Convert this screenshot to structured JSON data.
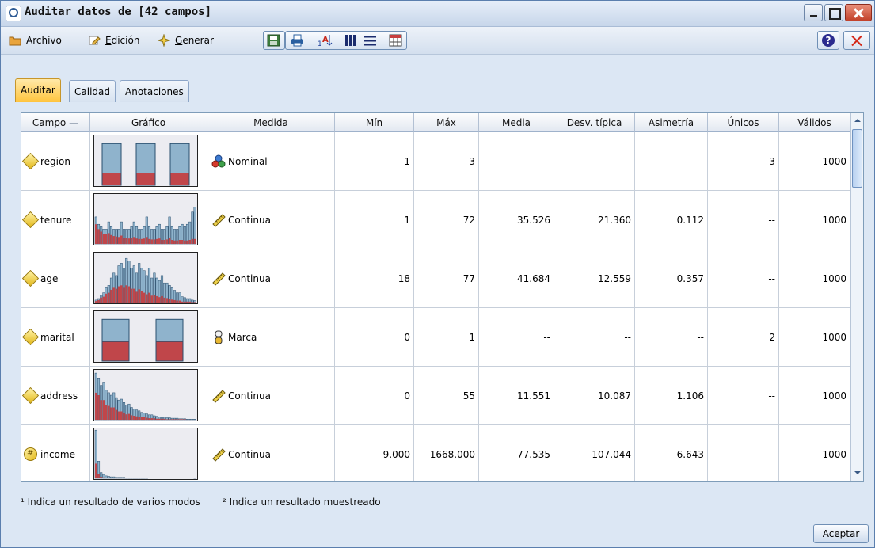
{
  "window": {
    "title": "Auditar datos de [42 campos]"
  },
  "menu": {
    "archivo": "Archivo",
    "edicion_first": "E",
    "edicion_rest": "dición",
    "generar_first": "G",
    "generar_rest": "enerar"
  },
  "tabs": [
    {
      "label": "Auditar",
      "active": true
    },
    {
      "label": "Calidad",
      "active": false
    },
    {
      "label": "Anotaciones",
      "active": false
    }
  ],
  "table": {
    "headers": [
      "Campo",
      "Gráfico",
      "Medida",
      "Mín",
      "Máx",
      "Media",
      "Desv. típica",
      "Asimetría",
      "Únicos",
      "Válidos"
    ],
    "sort_indicator": "—",
    "rows": [
      {
        "campo": "region",
        "medida": "Nominal",
        "min": "1",
        "max": "3",
        "media": "--",
        "desv": "--",
        "asim": "--",
        "unicos": "3",
        "validos": "1000",
        "field_icon": "diamond-icon",
        "medida_icon": "nominal-icon",
        "graph": {
          "type": "bars-3",
          "totals": [
            0.85,
            0.85,
            0.85
          ],
          "red": [
            0.25,
            0.25,
            0.25
          ]
        }
      },
      {
        "campo": "tenure",
        "medida": "Continua",
        "min": "1",
        "max": "72",
        "media": "35.526",
        "desv": "21.360",
        "asim": "0.112",
        "unicos": "--",
        "validos": "1000",
        "field_icon": "diamond-icon",
        "medida_icon": "ruler-icon",
        "graph": {
          "type": "hist",
          "totals": [
            0.55,
            0.4,
            0.35,
            0.3,
            0.3,
            0.45,
            0.35,
            0.3,
            0.3,
            0.3,
            0.45,
            0.3,
            0.3,
            0.3,
            0.35,
            0.45,
            0.35,
            0.3,
            0.3,
            0.35,
            0.55,
            0.35,
            0.3,
            0.3,
            0.35,
            0.4,
            0.3,
            0.3,
            0.35,
            0.55,
            0.35,
            0.3,
            0.3,
            0.35,
            0.4,
            0.35,
            0.4,
            0.45,
            0.65,
            0.75
          ],
          "red": [
            0.4,
            0.3,
            0.25,
            0.2,
            0.2,
            0.22,
            0.18,
            0.16,
            0.15,
            0.14,
            0.17,
            0.12,
            0.12,
            0.11,
            0.12,
            0.14,
            0.11,
            0.1,
            0.1,
            0.11,
            0.14,
            0.1,
            0.09,
            0.09,
            0.1,
            0.11,
            0.08,
            0.08,
            0.09,
            0.12,
            0.08,
            0.07,
            0.07,
            0.08,
            0.08,
            0.07,
            0.07,
            0.08,
            0.1,
            0.1
          ]
        }
      },
      {
        "campo": "age",
        "medida": "Continua",
        "min": "18",
        "max": "77",
        "media": "41.684",
        "desv": "12.559",
        "asim": "0.357",
        "unicos": "--",
        "validos": "1000",
        "field_icon": "diamond-icon",
        "medida_icon": "ruler-icon",
        "graph": {
          "type": "hist",
          "totals": [
            0.05,
            0.08,
            0.15,
            0.2,
            0.3,
            0.35,
            0.5,
            0.6,
            0.55,
            0.75,
            0.8,
            0.7,
            0.9,
            0.85,
            0.7,
            0.75,
            0.6,
            0.8,
            0.7,
            0.65,
            0.55,
            0.7,
            0.5,
            0.6,
            0.5,
            0.45,
            0.55,
            0.4,
            0.4,
            0.35,
            0.3,
            0.25,
            0.2,
            0.2,
            0.12,
            0.1,
            0.08,
            0.08,
            0.05,
            0.04
          ],
          "red": [
            0.03,
            0.05,
            0.1,
            0.12,
            0.18,
            0.2,
            0.26,
            0.3,
            0.28,
            0.33,
            0.35,
            0.3,
            0.35,
            0.33,
            0.28,
            0.28,
            0.22,
            0.27,
            0.23,
            0.2,
            0.17,
            0.2,
            0.14,
            0.16,
            0.13,
            0.11,
            0.13,
            0.1,
            0.09,
            0.08,
            0.06,
            0.05,
            0.04,
            0.04,
            0.02,
            0.02,
            0.02,
            0.02,
            0.01,
            0.01
          ]
        }
      },
      {
        "campo": "marital",
        "medida": "Marca",
        "min": "0",
        "max": "1",
        "media": "--",
        "desv": "--",
        "asim": "--",
        "unicos": "2",
        "validos": "1000",
        "field_icon": "diamond-icon",
        "medida_icon": "flag-icon",
        "graph": {
          "type": "bars-2",
          "totals": [
            0.85,
            0.85
          ],
          "red": [
            0.4,
            0.4
          ]
        }
      },
      {
        "campo": "address",
        "medida": "Continua",
        "min": "0",
        "max": "55",
        "media": "11.551",
        "desv": "10.087",
        "asim": "1.106",
        "unicos": "--",
        "validos": "1000",
        "field_icon": "diamond-icon",
        "medida_icon": "ruler-icon",
        "graph": {
          "type": "hist",
          "totals": [
            0.95,
            0.85,
            0.7,
            0.75,
            0.6,
            0.55,
            0.5,
            0.55,
            0.45,
            0.4,
            0.42,
            0.35,
            0.3,
            0.32,
            0.25,
            0.22,
            0.2,
            0.18,
            0.15,
            0.14,
            0.12,
            0.1,
            0.1,
            0.08,
            0.07,
            0.06,
            0.05,
            0.05,
            0.04,
            0.04,
            0.03,
            0.03,
            0.03,
            0.02,
            0.02,
            0.02,
            0.01,
            0.01,
            0.01,
            0.01
          ],
          "red": [
            0.55,
            0.5,
            0.4,
            0.4,
            0.3,
            0.28,
            0.25,
            0.25,
            0.2,
            0.17,
            0.17,
            0.14,
            0.11,
            0.12,
            0.09,
            0.08,
            0.07,
            0.06,
            0.05,
            0.05,
            0.04,
            0.03,
            0.03,
            0.03,
            0.02,
            0.02,
            0.02,
            0.02,
            0.01,
            0.01,
            0.01,
            0.01,
            0.01,
            0.01,
            0.01,
            0.01,
            0.0,
            0.0,
            0.0,
            0.0
          ]
        }
      },
      {
        "campo": "income",
        "medida": "Continua",
        "min": "9.000",
        "max": "1668.000",
        "media": "77.535",
        "desv": "107.044",
        "asim": "6.643",
        "unicos": "--",
        "validos": "1000",
        "field_icon": "money-icon",
        "medida_icon": "ruler-icon",
        "graph": {
          "type": "hist",
          "totals": [
            0.98,
            0.35,
            0.12,
            0.08,
            0.05,
            0.04,
            0.03,
            0.03,
            0.02,
            0.02,
            0.02,
            0.02,
            0.01,
            0.01,
            0.01,
            0.01,
            0.01,
            0.01,
            0.01,
            0.01,
            0.01,
            0.0,
            0.0,
            0.0,
            0.0,
            0.0,
            0.0,
            0.0,
            0.0,
            0.0,
            0.0,
            0.0,
            0.0,
            0.0,
            0.0,
            0.0,
            0.0,
            0.0,
            0.0,
            0.01
          ],
          "red": [
            0.3,
            0.08,
            0.03,
            0.02,
            0.01,
            0.01,
            0.01,
            0.01,
            0.0,
            0.0,
            0.0,
            0.0,
            0.0,
            0.0,
            0.0,
            0.0,
            0.0,
            0.0,
            0.0,
            0.0,
            0.0,
            0.0,
            0.0,
            0.0,
            0.0,
            0.0,
            0.0,
            0.0,
            0.0,
            0.0,
            0.0,
            0.0,
            0.0,
            0.0,
            0.0,
            0.0,
            0.0,
            0.0,
            0.0,
            0.0
          ]
        }
      }
    ]
  },
  "footnotes": {
    "note1": "¹ Indica un resultado de varios modos",
    "note2": "² Indica un resultado muestreado"
  },
  "buttons": {
    "ok": "Aceptar"
  },
  "colors": {
    "bar_blue": "#8fb3cc",
    "bar_red": "#c0464a",
    "bar_stroke": "#2a4f6e"
  }
}
